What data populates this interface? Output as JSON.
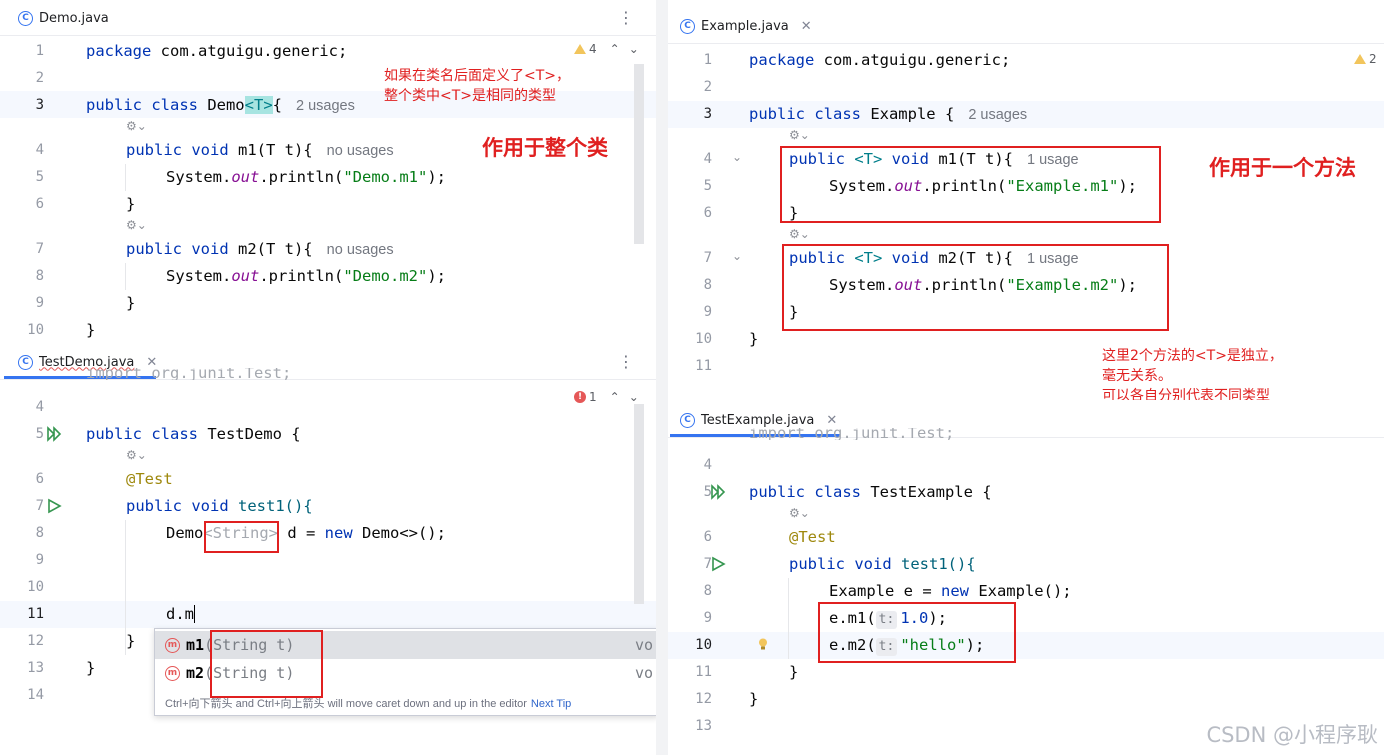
{
  "demo": {
    "tab": "Demo.java",
    "warn_count": "4",
    "lines": [
      "1",
      "2",
      "3",
      "4",
      "5",
      "6",
      "7",
      "8",
      "9",
      "10"
    ],
    "code": {
      "l1_kw": "package",
      "l1_rest": " com.atguigu.generic;",
      "l3_kw": "public class",
      "l3_name": " Demo",
      "l3_tp": "<T>",
      "l3_brace": "{",
      "l3_hint": "2 usages",
      "l4_kw": "public void",
      "l4_rest": " m1(T t){",
      "l4_hint": "no usages",
      "l5_pre": "System.",
      "l5_fld": "out",
      "l5_mid": ".println(",
      "l5_str": "\"Demo.m1\"",
      "l5_end": ");",
      "l6": "}",
      "l7_kw": "public void",
      "l7_rest": " m2(T t){",
      "l7_hint": "no usages",
      "l8_pre": "System.",
      "l8_fld": "out",
      "l8_mid": ".println(",
      "l8_str": "\"Demo.m2\"",
      "l8_end": ");",
      "l9": "}",
      "l10": "}"
    },
    "note_small": "如果在类名后面定义了<T>，\n整个类中<T>是相同的类型",
    "note_big": "作用于整个类"
  },
  "testdemo": {
    "tab": "TestDemo.java",
    "err_count": "1",
    "lines": [
      "4",
      "5",
      "6",
      "7",
      "8",
      "9",
      "10",
      "11",
      "12",
      "13",
      "14"
    ],
    "code": {
      "l3_partial": "import org.junit.Test;",
      "l5_kw": "public class",
      "l5_rest": " TestDemo {",
      "l6": "@Test",
      "l7_kw": "public void",
      "l7_rest": " test1(){",
      "l8_a": "Demo",
      "l8_b": "<String>",
      "l8_c": " d = ",
      "l8_kw": "new",
      "l8_d": " Demo<>();",
      "l11": "d.m",
      "l12": "}",
      "l13": "}"
    },
    "popup": {
      "items": [
        {
          "name": "m1",
          "sig": "(String t)",
          "ret": "vo"
        },
        {
          "name": "m2",
          "sig": "(String t)",
          "ret": "vo"
        }
      ],
      "footer": "Ctrl+向下箭头 and Ctrl+向上箭头 will move caret down and up in the editor",
      "tip": "Next Tip"
    }
  },
  "example": {
    "tab": "Example.java",
    "warn_count": "2",
    "lines": [
      "1",
      "2",
      "3",
      "4",
      "5",
      "6",
      "7",
      "8",
      "9",
      "10",
      "11"
    ],
    "code": {
      "l1_kw": "package",
      "l1_rest": " com.atguigu.generic;",
      "l3_kw": "public class",
      "l3_rest": " Example {",
      "l3_hint": "2 usages",
      "l4_kw": "public",
      "l4_tp": " <T>",
      "l4_kw2": " void",
      "l4_rest": " m1(T t){",
      "l4_hint": "1 usage",
      "l5_pre": "System.",
      "l5_fld": "out",
      "l5_mid": ".println(",
      "l5_str": "\"Example.m1\"",
      "l5_end": ");",
      "l6": "}",
      "l7_kw": "public",
      "l7_tp": " <T>",
      "l7_kw2": " void",
      "l7_rest": " m2(T t){",
      "l7_hint": "1 usage",
      "l8_pre": "System.",
      "l8_fld": "out",
      "l8_mid": ".println(",
      "l8_str": "\"Example.m2\"",
      "l8_end": ");",
      "l9": "}",
      "l10": "}"
    },
    "note_big": "作用于一个方法",
    "note_small": "这里2个方法的<T>是独立，\n毫无关系。\n可以各自分别代表不同类型"
  },
  "testexample": {
    "tab": "TestExample.java",
    "lines": [
      "4",
      "5",
      "6",
      "7",
      "8",
      "9",
      "10",
      "11",
      "12",
      "13"
    ],
    "code": {
      "l3_partial": "import org.junit.Test;",
      "l5_kw": "public class",
      "l5_rest": " TestExample {",
      "l6": "@Test",
      "l7_kw": "public void",
      "l7_rest": " test1(){",
      "l8_a": "Example e = ",
      "l8_kw": "new",
      "l8_b": " Example();",
      "l9_a": "e.m1(",
      "l9_inlay": "t:",
      "l9_num": "1.0",
      "l9_end": ");",
      "l10_a": "e.m2(",
      "l10_inlay": "t:",
      "l10_str": "\"hello\"",
      "l10_end": ");",
      "l11": "}",
      "l12": "}"
    }
  },
  "watermark": "CSDN @小程序耿",
  "colors": {
    "keyword": "#0033b3",
    "string": "#067d17",
    "field": "#871094",
    "annotation": "#9e880d",
    "annotation_red": "#e02020",
    "accent": "#3574f0"
  }
}
